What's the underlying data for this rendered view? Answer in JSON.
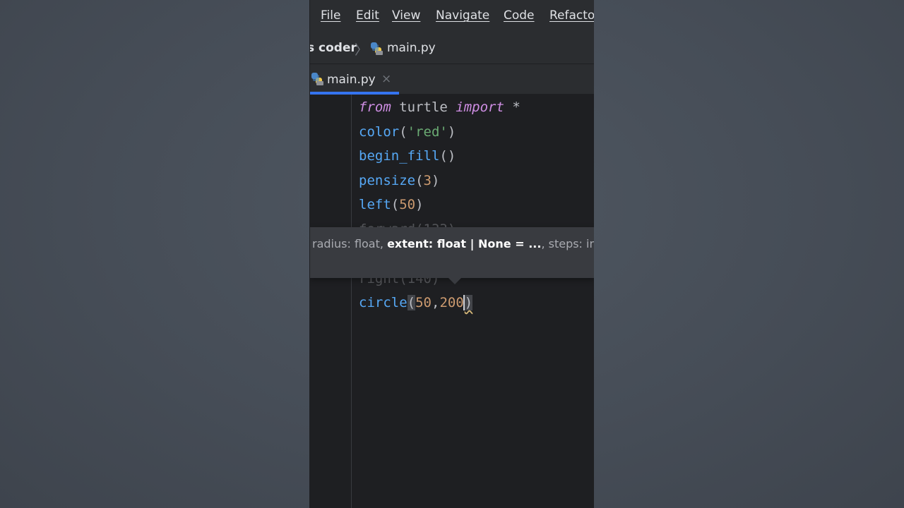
{
  "menubar": {
    "items": [
      "File",
      "Edit",
      "View",
      "Navigate",
      "Code",
      "Refacto"
    ]
  },
  "breadcrumb": {
    "project": "s coder",
    "file": "main.py"
  },
  "tab": {
    "label": "main.py",
    "close": "×"
  },
  "code": {
    "line1": {
      "kw1": "from",
      "mod": " turtle ",
      "kw2": "import",
      "star": " *"
    },
    "line2": {
      "fn": "color",
      "open": "(",
      "str": "'red'",
      "close": ")"
    },
    "line3": {
      "fn": "begin_fill",
      "args": "()"
    },
    "line4": {
      "fn": "pensize",
      "open": "(",
      "num": "3",
      "close": ")"
    },
    "line5": {
      "fn": "left",
      "open": "(",
      "num": "50",
      "close": ")"
    },
    "line6_partial": "forward(133)",
    "line7_partial": "right(140)",
    "line8": {
      "fn": "circle",
      "open": "(",
      "num1": "50",
      "comma": ",",
      "num2": "200",
      "close": ")"
    }
  },
  "param_hint": {
    "before": "radius: float, ",
    "bold": "extent: float | None = ...",
    "after": ", steps: int"
  },
  "colors": {
    "keyword": "#cf8ee4",
    "function": "#56a8f5",
    "string": "#6aab73",
    "number": "#cc9a6f",
    "accent": "#3574f0"
  }
}
